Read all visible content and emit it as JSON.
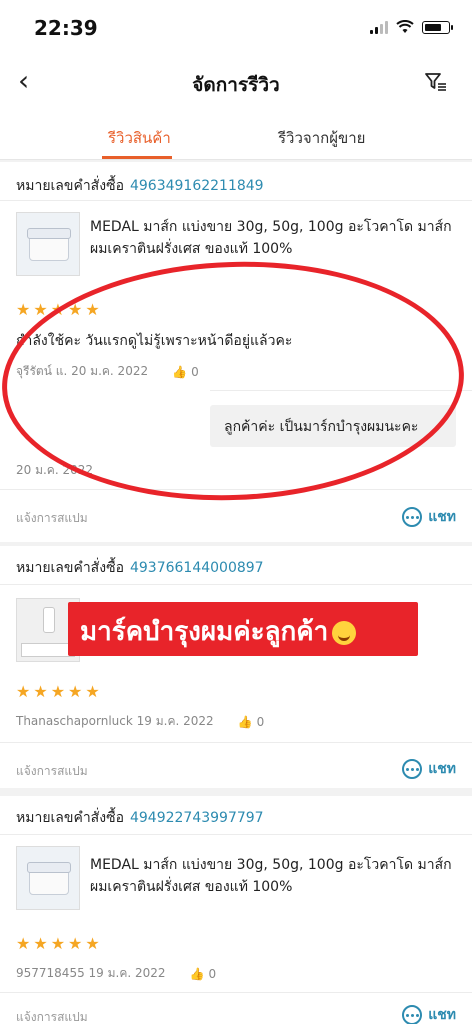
{
  "status_bar": {
    "time": "22:39"
  },
  "header": {
    "title": "จัดการรีวิว"
  },
  "tabs": [
    {
      "label": "รีวิวสินค้า",
      "active": true
    },
    {
      "label": "รีวิวจากผู้ขาย",
      "active": false
    }
  ],
  "reviews": [
    {
      "order_label": "หมายเลขคำสั่งซื้อ",
      "order_number": "496349162211849",
      "product_name": "MEDAL มาส์ก แบ่งขาย 30g, 50g, 100g อะโวคาโด มาส์กผมเคราตินฝรั่งเศส ของแท้ 100%",
      "stars": "★★★★★",
      "review_text": "กำลังใช้คะ วันแรกดูไม่รู้เพราะหน้าดีอยู่แล้วคะ",
      "reviewer_date": "จุรีรัตน์ แ. 20 ม.ค. 2022",
      "likes": "0",
      "seller_reply": "ลูกค้าค่ะ เป็นมาร์กบำรุงผมนะคะ",
      "reply_date": "20 ม.ค. 2022",
      "report_label": "แจ้งการสแปม",
      "chat_label": "แชท"
    },
    {
      "order_label": "หมายเลขคำสั่งซื้อ",
      "order_number": "493766144000897",
      "stars": "★★★★★",
      "reviewer_date": "Thanaschapornluck 19 ม.ค. 2022",
      "likes": "0",
      "report_label": "แจ้งการสแปม",
      "chat_label": "แชท"
    },
    {
      "order_label": "หมายเลขคำสั่งซื้อ",
      "order_number": "494922743997797",
      "product_name": "MEDAL มาส์ก แบ่งขาย 30g, 50g, 100g อะโวคาโด มาส์กผมเคราตินฝรั่งเศส ของแท้ 100%",
      "stars": "★★★★★",
      "reviewer_date": "957718455 19 ม.ค. 2022",
      "likes": "0",
      "report_label": "แจ้งการสแปม",
      "chat_label": "แชท"
    }
  ],
  "annotation": {
    "banner_text": "มาร์คบำรุงผมค่ะลูกค้า"
  },
  "colors": {
    "accent": "#e85f2a",
    "link": "#2d8bb0",
    "star": "#f5a623",
    "annotation": "#e8242a"
  }
}
